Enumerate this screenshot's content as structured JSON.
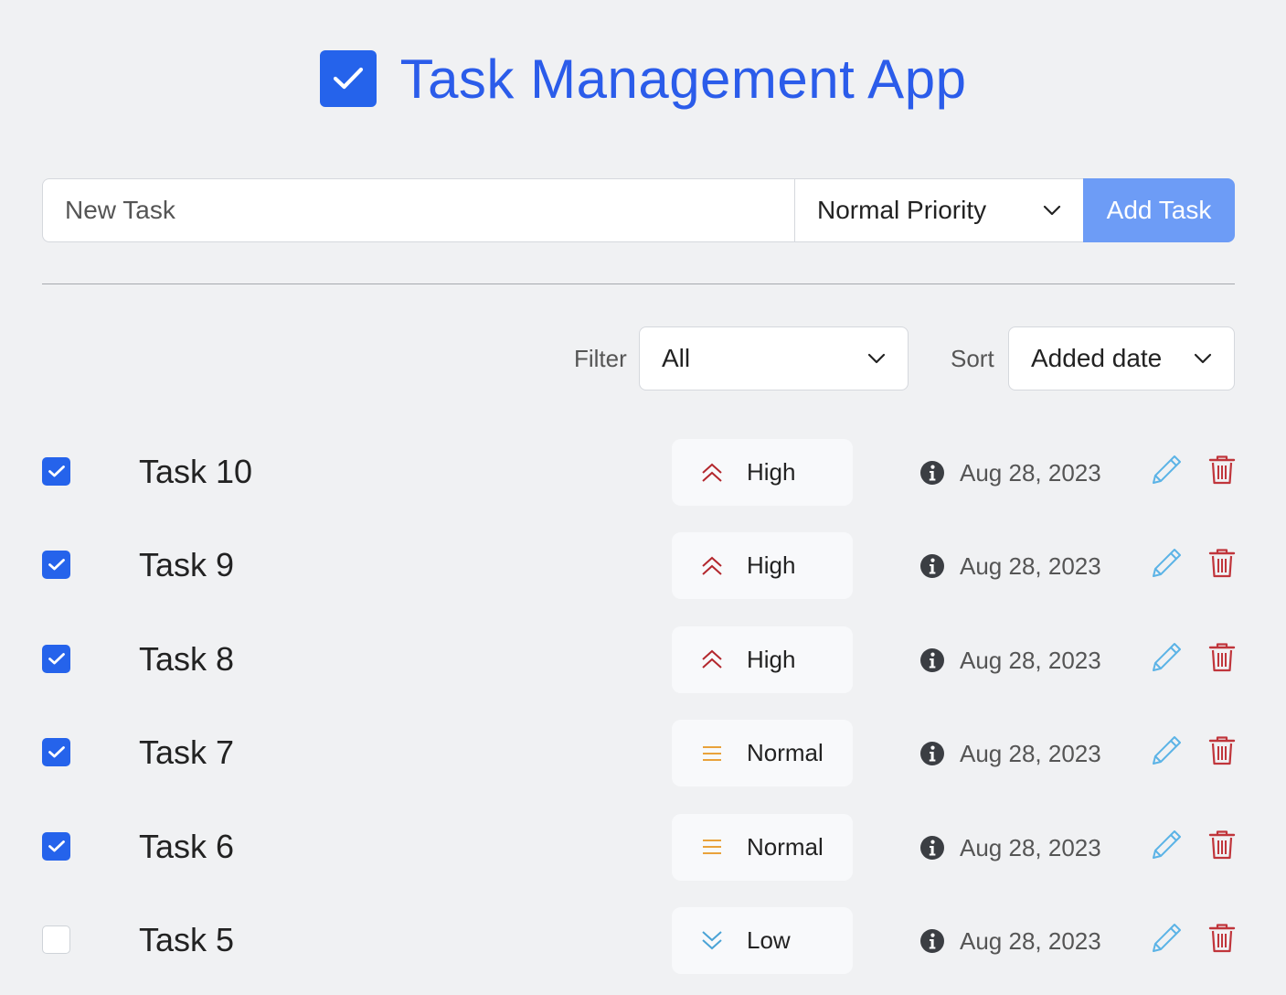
{
  "header": {
    "title": "Task Management App",
    "logo_icon": "checkbox-checked-icon",
    "title_color": "#2b5cea"
  },
  "new_task": {
    "input_value": "",
    "input_placeholder": "New Task",
    "priority_selected": "Normal Priority",
    "add_button_label": "Add Task",
    "add_button_color": "#6d9cf6"
  },
  "controls": {
    "filter_label": "Filter",
    "filter_selected": "All",
    "sort_label": "Sort",
    "sort_selected": "Added date"
  },
  "priority_colors": {
    "High": "#b3272d",
    "Normal": "#e9a23b",
    "Low": "#4aa3d6"
  },
  "tasks": [
    {
      "name": "Task 10",
      "checked": true,
      "priority": "High",
      "priority_icon": "double-chevron-up-icon",
      "date": "Aug 28, 2023"
    },
    {
      "name": "Task 9",
      "checked": true,
      "priority": "High",
      "priority_icon": "double-chevron-up-icon",
      "date": "Aug 28, 2023"
    },
    {
      "name": "Task 8",
      "checked": true,
      "priority": "High",
      "priority_icon": "double-chevron-up-icon",
      "date": "Aug 28, 2023"
    },
    {
      "name": "Task 7",
      "checked": true,
      "priority": "Normal",
      "priority_icon": "equals-lines-icon",
      "date": "Aug 28, 2023"
    },
    {
      "name": "Task 6",
      "checked": true,
      "priority": "Normal",
      "priority_icon": "equals-lines-icon",
      "date": "Aug 28, 2023"
    },
    {
      "name": "Task 5",
      "checked": false,
      "priority": "Low",
      "priority_icon": "double-chevron-down-icon",
      "date": "Aug 28, 2023"
    }
  ]
}
